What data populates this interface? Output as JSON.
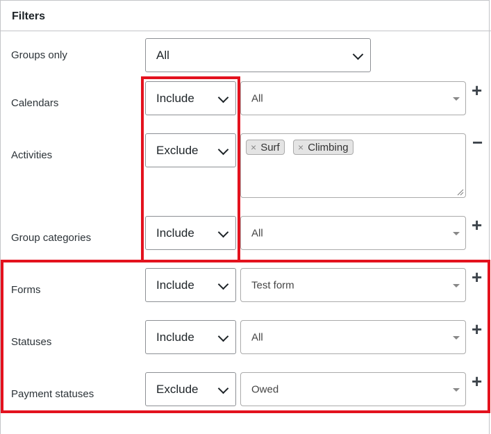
{
  "header": {
    "title": "Filters"
  },
  "rows": {
    "groups_only": {
      "label": "Groups only",
      "value": "All"
    },
    "calendars": {
      "label": "Calendars",
      "mode": "Include",
      "value": "All"
    },
    "activities": {
      "label": "Activities",
      "mode": "Exclude",
      "tags": [
        "Surf",
        "Climbing"
      ]
    },
    "group_categories": {
      "label": "Group categories",
      "mode": "Include",
      "value": "All"
    },
    "forms": {
      "label": "Forms",
      "mode": "Include",
      "value": "Test form"
    },
    "statuses": {
      "label": "Statuses",
      "mode": "Include",
      "value": "All"
    },
    "payment_statuses": {
      "label": "Payment statuses",
      "mode": "Exclude",
      "value": "Owed"
    }
  },
  "icons": {
    "add": "+",
    "remove": "−",
    "tag_remove": "×"
  },
  "colors": {
    "highlight": "#e3121e"
  }
}
